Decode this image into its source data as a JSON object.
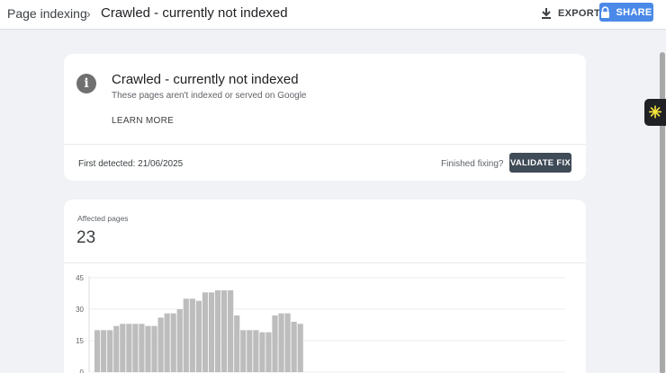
{
  "header": {
    "breadcrumb_parent": "Page indexing",
    "breadcrumb_separator": "›",
    "title": "Crawled - currently not indexed",
    "export_label": "EXPORT",
    "share_label": "SHARE",
    "export_icon": "download-icon",
    "share_icon": "lock-icon"
  },
  "issue_card": {
    "icon": "info-icon",
    "icon_glyph": "i",
    "title": "Crawled - currently not indexed",
    "subtitle": "These pages aren't indexed or served on Google",
    "learn_more": "LEARN MORE",
    "first_detected": "First detected: 21/06/2025",
    "finished_fixing": "Finished fixing?",
    "validate_fix": "VALIDATE FIX"
  },
  "affected": {
    "label": "Affected pages",
    "value": "23"
  },
  "chart_data": {
    "type": "bar",
    "y_ticks": [
      "45",
      "30",
      "15",
      "0"
    ],
    "ylim": [
      0,
      45
    ],
    "values": [
      20,
      20,
      20,
      22,
      23,
      23,
      23,
      23,
      22,
      22,
      26,
      28,
      28,
      30,
      35,
      35,
      34,
      38,
      38,
      39,
      39,
      39,
      27,
      20,
      20,
      20,
      19,
      19,
      27,
      28,
      28,
      24,
      23
    ]
  },
  "colors": {
    "accent": "#4a89e8",
    "validate_bg": "#3f4b57",
    "bar": "#bdbdbd",
    "extension": "#f7e43c"
  },
  "extension": {
    "icon": "sparkle-icon",
    "glyph": "✳"
  }
}
